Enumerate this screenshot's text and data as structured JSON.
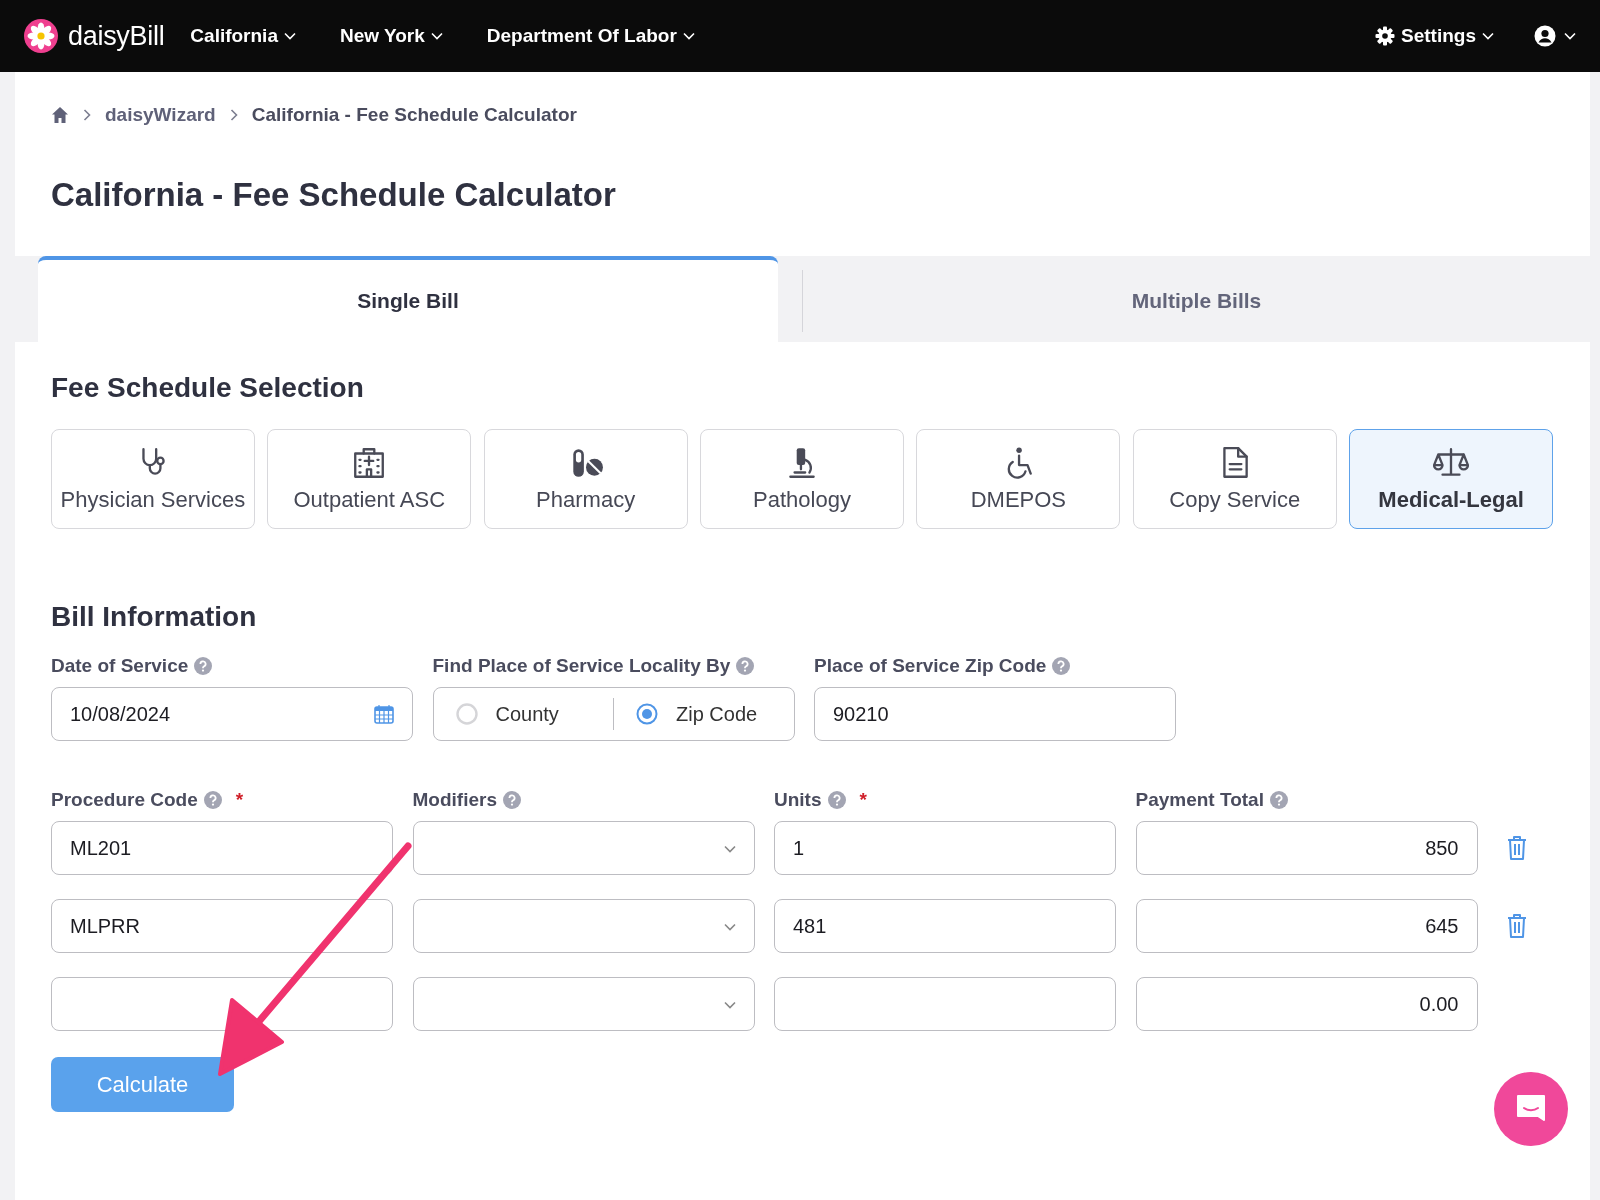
{
  "nav": {
    "logo": "daisy**Bill**",
    "menus": [
      "California",
      "New York",
      "Department Of Labor"
    ],
    "settings": "Settings"
  },
  "breadcrumb": [
    "daisyWizard",
    "California - Fee Schedule Calculator"
  ],
  "title": "California - Fee Schedule Calculator",
  "tabs": [
    {
      "label": "Single Bill",
      "selected": true
    },
    {
      "label": "Multiple Bills",
      "selected": false
    }
  ],
  "fee_schedule": {
    "heading": "Fee Schedule Selection",
    "options": [
      {
        "label": "Physician Services",
        "selected": false
      },
      {
        "label": "Outpatient ASC",
        "selected": false
      },
      {
        "label": "Pharmacy",
        "selected": false
      },
      {
        "label": "Pathology",
        "selected": false
      },
      {
        "label": "DMEPOS",
        "selected": false
      },
      {
        "label": "Copy Service",
        "selected": false
      },
      {
        "label": "Medical-Legal",
        "selected": true
      }
    ]
  },
  "bill_information": {
    "heading": "Bill Information",
    "date_of_service": {
      "label": "Date of Service",
      "value": "10/08/2024"
    },
    "locality": {
      "label": "Find Place of Service Locality By",
      "options": [
        {
          "label": "County",
          "selected": false
        },
        {
          "label": "Zip Code",
          "selected": true
        }
      ]
    },
    "zip_code": {
      "label": "Place of Service Zip Code",
      "value": "90210"
    },
    "columns": [
      {
        "label": "Procedure Code",
        "required_mark": "*"
      },
      {
        "label": "Modifiers"
      },
      {
        "label": "Units",
        "required_mark": "*"
      },
      {
        "label": "Payment Total"
      }
    ],
    "rows": [
      {
        "procedure_code": "ML201",
        "units": "1",
        "payment_total": "850",
        "deletable": true
      },
      {
        "procedure_code": "MLPRR",
        "units": "481",
        "payment_total": "645",
        "deletable": true
      },
      {
        "payment_total": "0.00",
        "deletable": false
      }
    ]
  },
  "calculate_button": "Calculate"
}
